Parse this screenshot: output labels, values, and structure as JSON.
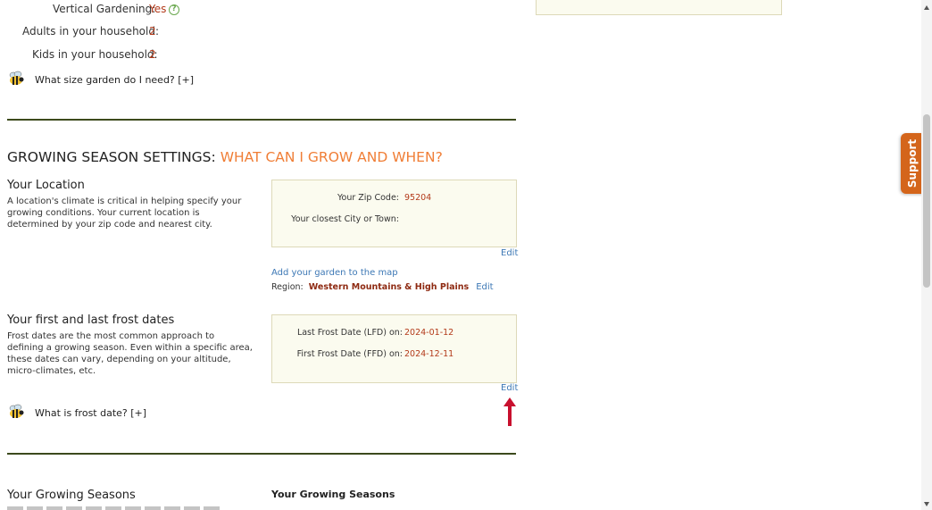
{
  "top_prefs": {
    "vertical_label": "Vertical Gardening:",
    "vertical_value": "Yes",
    "adults_label": "Adults in your household:",
    "adults_value": "2",
    "kids_label": "Kids in your household:",
    "kids_value": "2",
    "garden_size_link": "What size garden do I need? [+]"
  },
  "section": {
    "title_main": "GROWING SEASON SETTINGS:",
    "title_accent": "WHAT CAN I GROW AND WHEN?"
  },
  "location": {
    "heading": "Your Location",
    "description": "A location's climate is critical in helping specify your growing conditions. Your current location is determined by your zip code and nearest city.",
    "zip_label": "Your Zip Code:",
    "zip_value": "95204",
    "city_label": "Your closest City or Town:",
    "city_value": "",
    "edit": "Edit",
    "add_map_link": "Add your garden to the map",
    "region_label": "Region:",
    "region_value": "Western Mountains & High Plains",
    "region_edit": "Edit"
  },
  "frost": {
    "heading": "Your first and last frost dates",
    "description": "Frost dates are the most common approach to defining a growing season. Even within a specific area, these dates can vary, depending on your altitude, micro-climates, etc.",
    "lfd_label": "Last Frost Date (LFD) on:",
    "lfd_value": "2024-01-12",
    "ffd_label": "First Frost Date (FFD) on:",
    "ffd_value": "2024-12-11",
    "edit": "Edit",
    "what_is_link": "What is frost date? [+]"
  },
  "seasons": {
    "heading": "Your Growing Seasons",
    "right_heading": "Your Growing Seasons"
  },
  "support": {
    "label": "Support"
  },
  "colors": {
    "accent_orange": "#f07e36",
    "value_red": "#b33a1a",
    "rule_green": "#3c4a1c",
    "box_bg": "#fbfbef",
    "link_blue": "#3d78b5",
    "support_bg": "#d4651b",
    "arrow_red": "#c8102e"
  }
}
